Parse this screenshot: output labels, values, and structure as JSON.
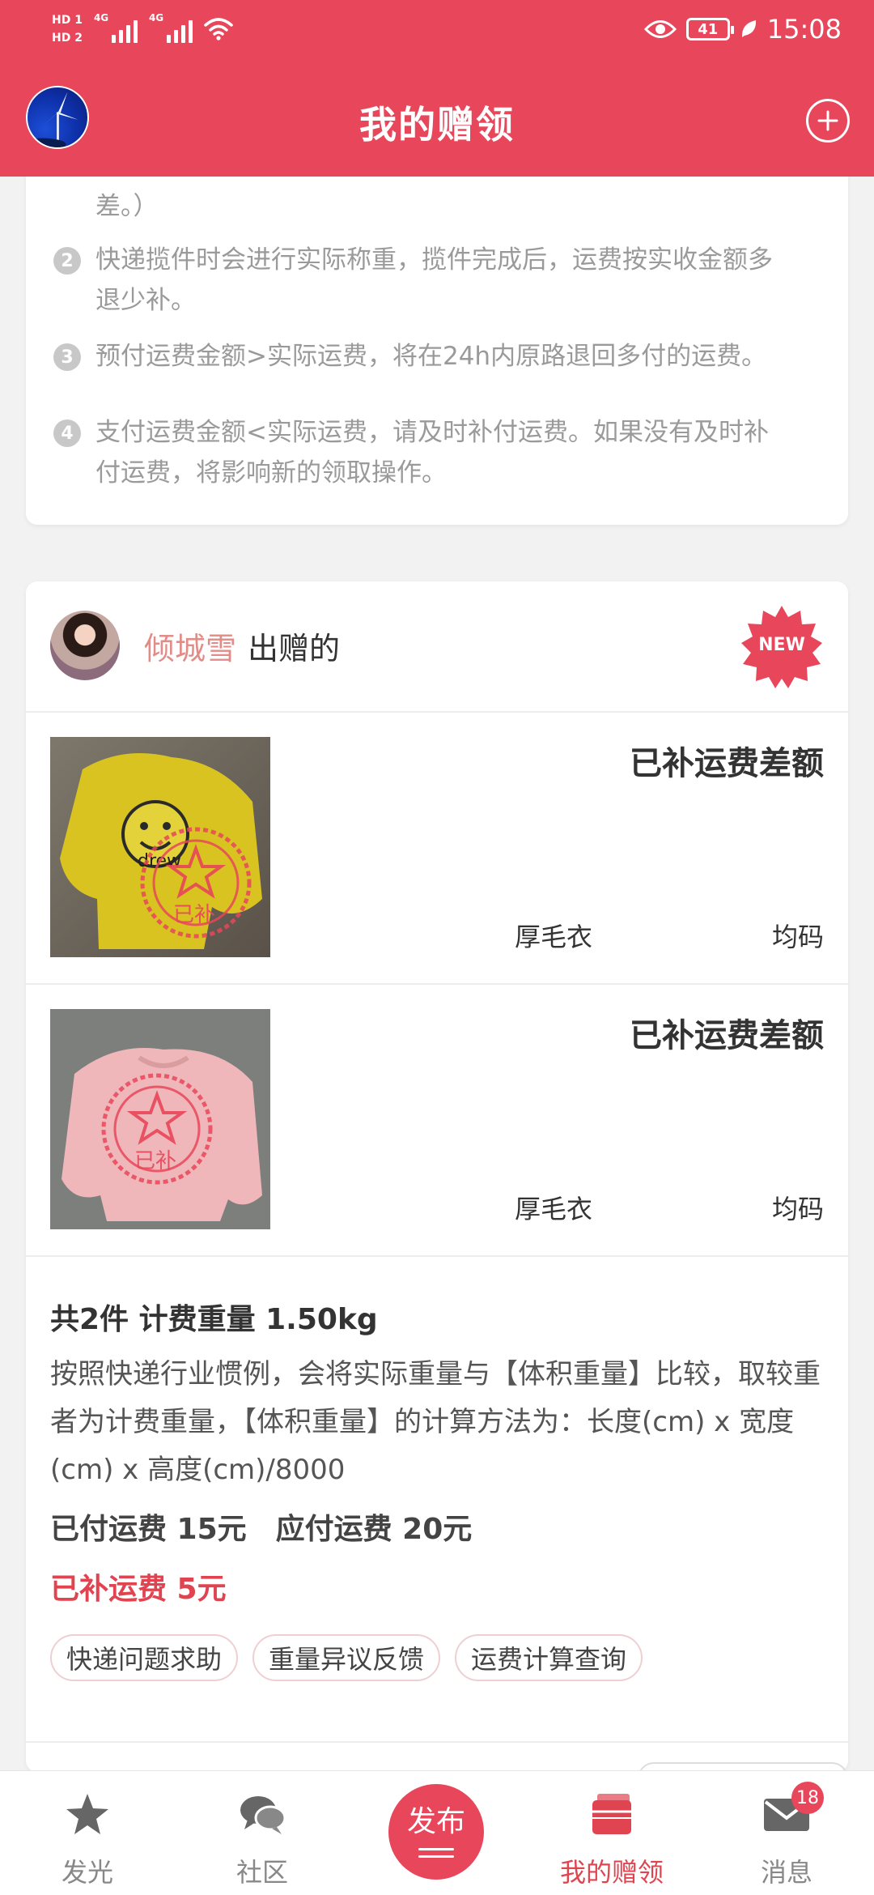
{
  "status_bar": {
    "hd1": "HD 1",
    "hd2": "HD 2",
    "net1": "4G",
    "net2": "4G",
    "battery": "41",
    "time": "15:08",
    "icons": [
      "signal-icon",
      "wifi-icon",
      "eye-icon",
      "battery-icon",
      "leaf-icon"
    ]
  },
  "header": {
    "title": "我的赠领",
    "add_icon": "plus-circle-icon",
    "avatar_icon": "user-avatar"
  },
  "notes": {
    "line0": "差。）",
    "items": [
      {
        "num": "2",
        "line1": "快递揽件时会进行实际称重，揽件完成后，运费按实收金额多",
        "line2": "退少补。"
      },
      {
        "num": "3",
        "line1": "预付运费金额>实际运费，将在24h内原路退回多付的运费。"
      },
      {
        "num": "4",
        "line1": "支付运费金额<实际运费，请及时补付运费。如果没有及时补",
        "line2": "付运费，将影响新的领取操作。"
      }
    ]
  },
  "donation": {
    "donor_name": "倾城雪",
    "donor_suffix": "出赠的",
    "new_badge": "NEW",
    "items": [
      {
        "status": "已补运费差额",
        "name": "厚毛衣",
        "size": "均码",
        "stamp": "已补",
        "garment_color": "#d9c21f",
        "print": "drew"
      },
      {
        "status": "已补运费差额",
        "name": "厚毛衣",
        "size": "均码",
        "stamp": "已补",
        "garment_color": "#efb7b9",
        "print": ""
      }
    ],
    "summary": {
      "title": "共2件 计费重量 1.50kg",
      "desc": "按照快递行业惯例，会将实际重量与【体积重量】比较，取较重者为计费重量，【体积重量】的计算方法为：长度(cm) x 宽度(cm) x 高度(cm)/8000",
      "paid": "已付运费 15元",
      "due": "应付运费 20元",
      "extra": "已补运费 5元"
    },
    "chips": [
      "快递问题求助",
      "重量异议反馈",
      "运费计算查询"
    ]
  },
  "nav": {
    "items": [
      {
        "label": "发光",
        "icon": "star-icon"
      },
      {
        "label": "社区",
        "icon": "chat-bubbles-icon"
      },
      {
        "label": "发布",
        "icon": "publish-icon"
      },
      {
        "label": "我的赠领",
        "icon": "gift-box-icon",
        "active": true
      },
      {
        "label": "消息",
        "icon": "mail-icon",
        "badge": "18"
      }
    ]
  },
  "colors": {
    "brand": "#e8465a",
    "donor_name": "#e38b86",
    "extra_fee": "#e04451"
  }
}
